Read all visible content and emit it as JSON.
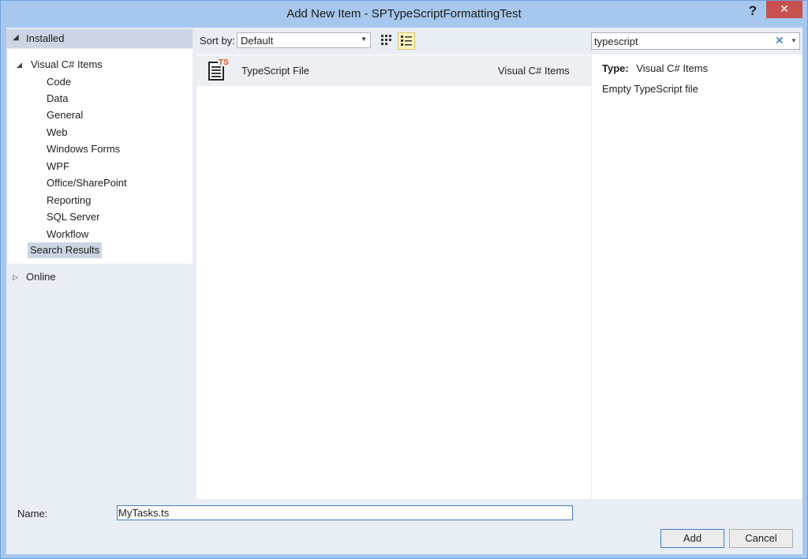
{
  "window": {
    "title": "Add New Item - SPTypeScriptFormattingTest",
    "help_label": "?",
    "close_label": "✕"
  },
  "tree": {
    "installed_label": "Installed",
    "root_label": "Visual C# Items",
    "children": [
      "Code",
      "Data",
      "General",
      "Web",
      "Windows Forms",
      "WPF",
      "Office/SharePoint",
      "Reporting",
      "SQL Server",
      "Workflow"
    ],
    "selected_label": "Search Results",
    "online_label": "Online"
  },
  "toolbar": {
    "sort_label": "Sort by:",
    "sort_value": "Default",
    "search_value": "typescript"
  },
  "items": [
    {
      "name": "TypeScript File",
      "category": "Visual C# Items",
      "icon": "typescript-file-icon",
      "icon_badge": "TS"
    }
  ],
  "details": {
    "type_label": "Type:",
    "type_value": "Visual C# Items",
    "description": "Empty TypeScript file"
  },
  "footer": {
    "name_label": "Name:",
    "name_value": "MyTasks.ts",
    "add_label": "Add",
    "cancel_label": "Cancel"
  },
  "colors": {
    "frame": "#a6c8ee",
    "close_button": "#c75050",
    "selected_bg": "#ccd5e3",
    "badge": "#d9531e"
  }
}
